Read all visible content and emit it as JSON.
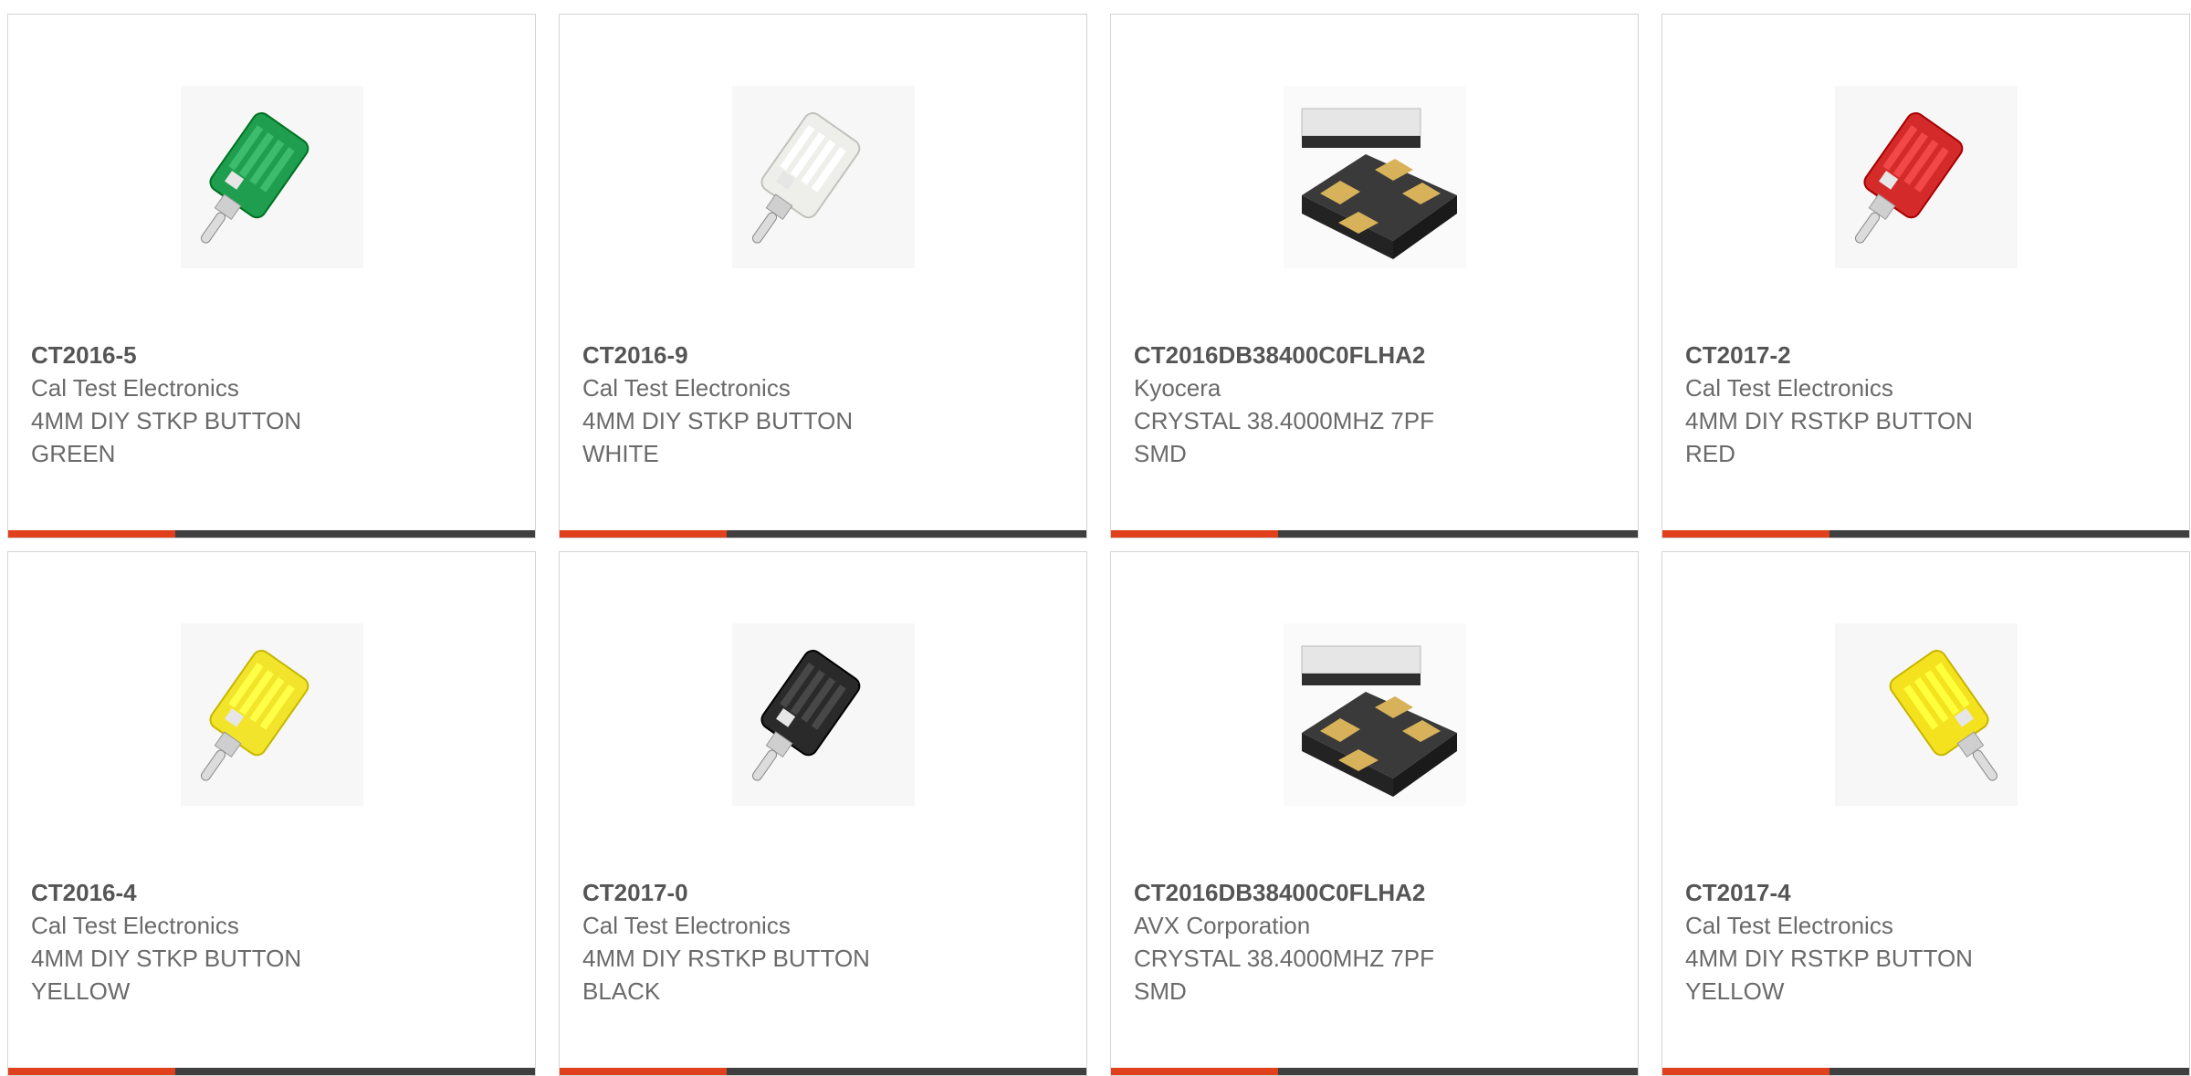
{
  "products": [
    {
      "part_number": "CT2016-5",
      "manufacturer": "Cal Test Electronics",
      "description": "4MM DIY STKP BUTTON GREEN",
      "image_icon": "banana-plug-icon",
      "image_color": "#1e9e4e"
    },
    {
      "part_number": "CT2016-9",
      "manufacturer": "Cal Test Electronics",
      "description": "4MM DIY STKP BUTTON WHITE",
      "image_icon": "banana-plug-icon",
      "image_color": "#eeeeea"
    },
    {
      "part_number": "CT2016DB38400C0FLHA2",
      "manufacturer": "Kyocera",
      "description": "CRYSTAL 38.4000MHZ 7PF SMD",
      "image_icon": "smd-crystal-icon",
      "image_color": "#2e2e2e"
    },
    {
      "part_number": "CT2017-2",
      "manufacturer": "Cal Test Electronics",
      "description": "4MM DIY RSTKP BUTTON RED",
      "image_icon": "banana-plug-icon",
      "image_color": "#d42a2a"
    },
    {
      "part_number": "CT2016-4",
      "manufacturer": "Cal Test Electronics",
      "description": "4MM DIY STKP BUTTON YELLOW",
      "image_icon": "banana-plug-icon",
      "image_color": "#f2e42a"
    },
    {
      "part_number": "CT2017-0",
      "manufacturer": "Cal Test Electronics",
      "description": "4MM DIY RSTKP BUTTON BLACK",
      "image_icon": "banana-plug-icon",
      "image_color": "#2a2a2a"
    },
    {
      "part_number": "CT2016DB38400C0FLHA2",
      "manufacturer": "AVX Corporation",
      "description": "CRYSTAL 38.4000MHZ 7PF SMD",
      "image_icon": "smd-crystal-icon",
      "image_color": "#2e2e2e"
    },
    {
      "part_number": "CT2017-4",
      "manufacturer": "Cal Test Electronics",
      "description": "4MM DIY RSTKP BUTTON YELLOW",
      "image_icon": "banana-plug-icon",
      "image_color": "#f4e21e"
    }
  ],
  "colors": {
    "accent": "#e0401c",
    "bar": "#3f3f3f",
    "border": "#d4d4d4",
    "part_text": "#555555",
    "body_text": "#6a6a6a"
  }
}
